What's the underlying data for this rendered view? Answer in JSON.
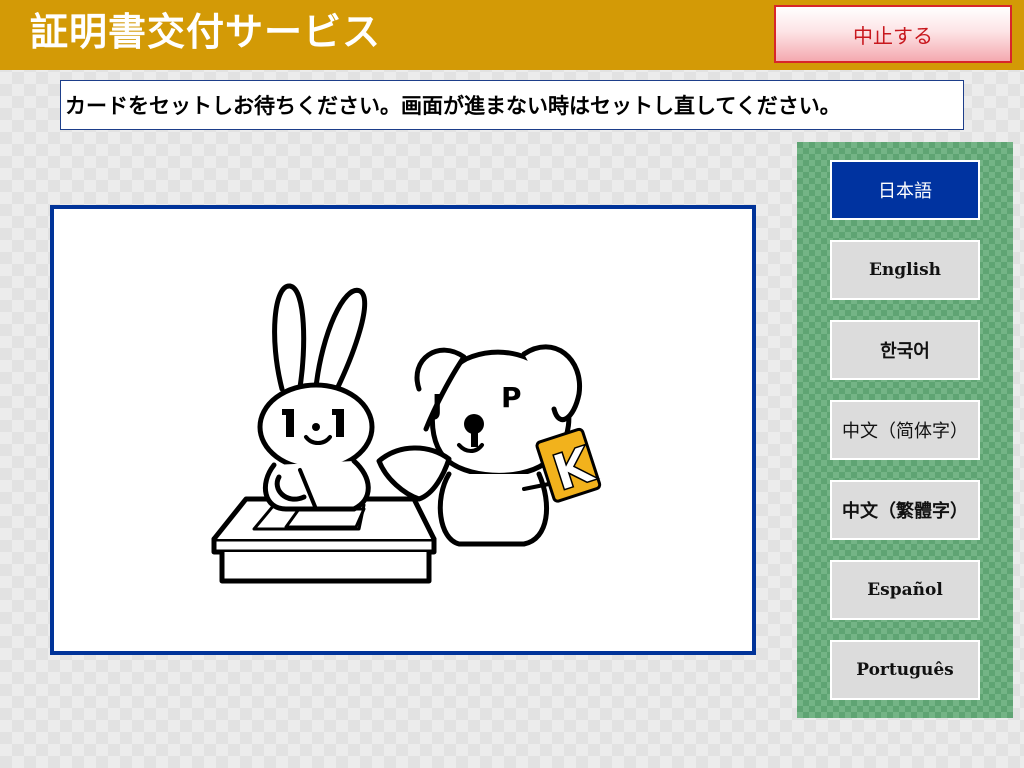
{
  "header": {
    "title": "証明書交付サービス",
    "cancel_label": "中止する"
  },
  "message": "カードをセットしお待ちください。画面が進まない時はセットし直してください。",
  "illustration": {
    "rabbit_face_text": "1.1",
    "dog_ear_letters": [
      "J",
      "P"
    ],
    "sign_letter": "K"
  },
  "languages": [
    {
      "label": "日本語",
      "selected": true
    },
    {
      "label": "English",
      "selected": false
    },
    {
      "label": "한국어",
      "selected": false
    },
    {
      "label": "中文（简体字）",
      "selected": false
    },
    {
      "label": "中文（繁體字）",
      "selected": false
    },
    {
      "label": "Español",
      "selected": false
    },
    {
      "label": "Português",
      "selected": false
    }
  ],
  "colors": {
    "header_bg": "#d39a06",
    "cancel_border": "#d8262a",
    "panel_border": "#003399",
    "selected_lang": "#0033a0",
    "lang_panel": "#5fa473",
    "mascot_sign": "#f2b21c"
  }
}
